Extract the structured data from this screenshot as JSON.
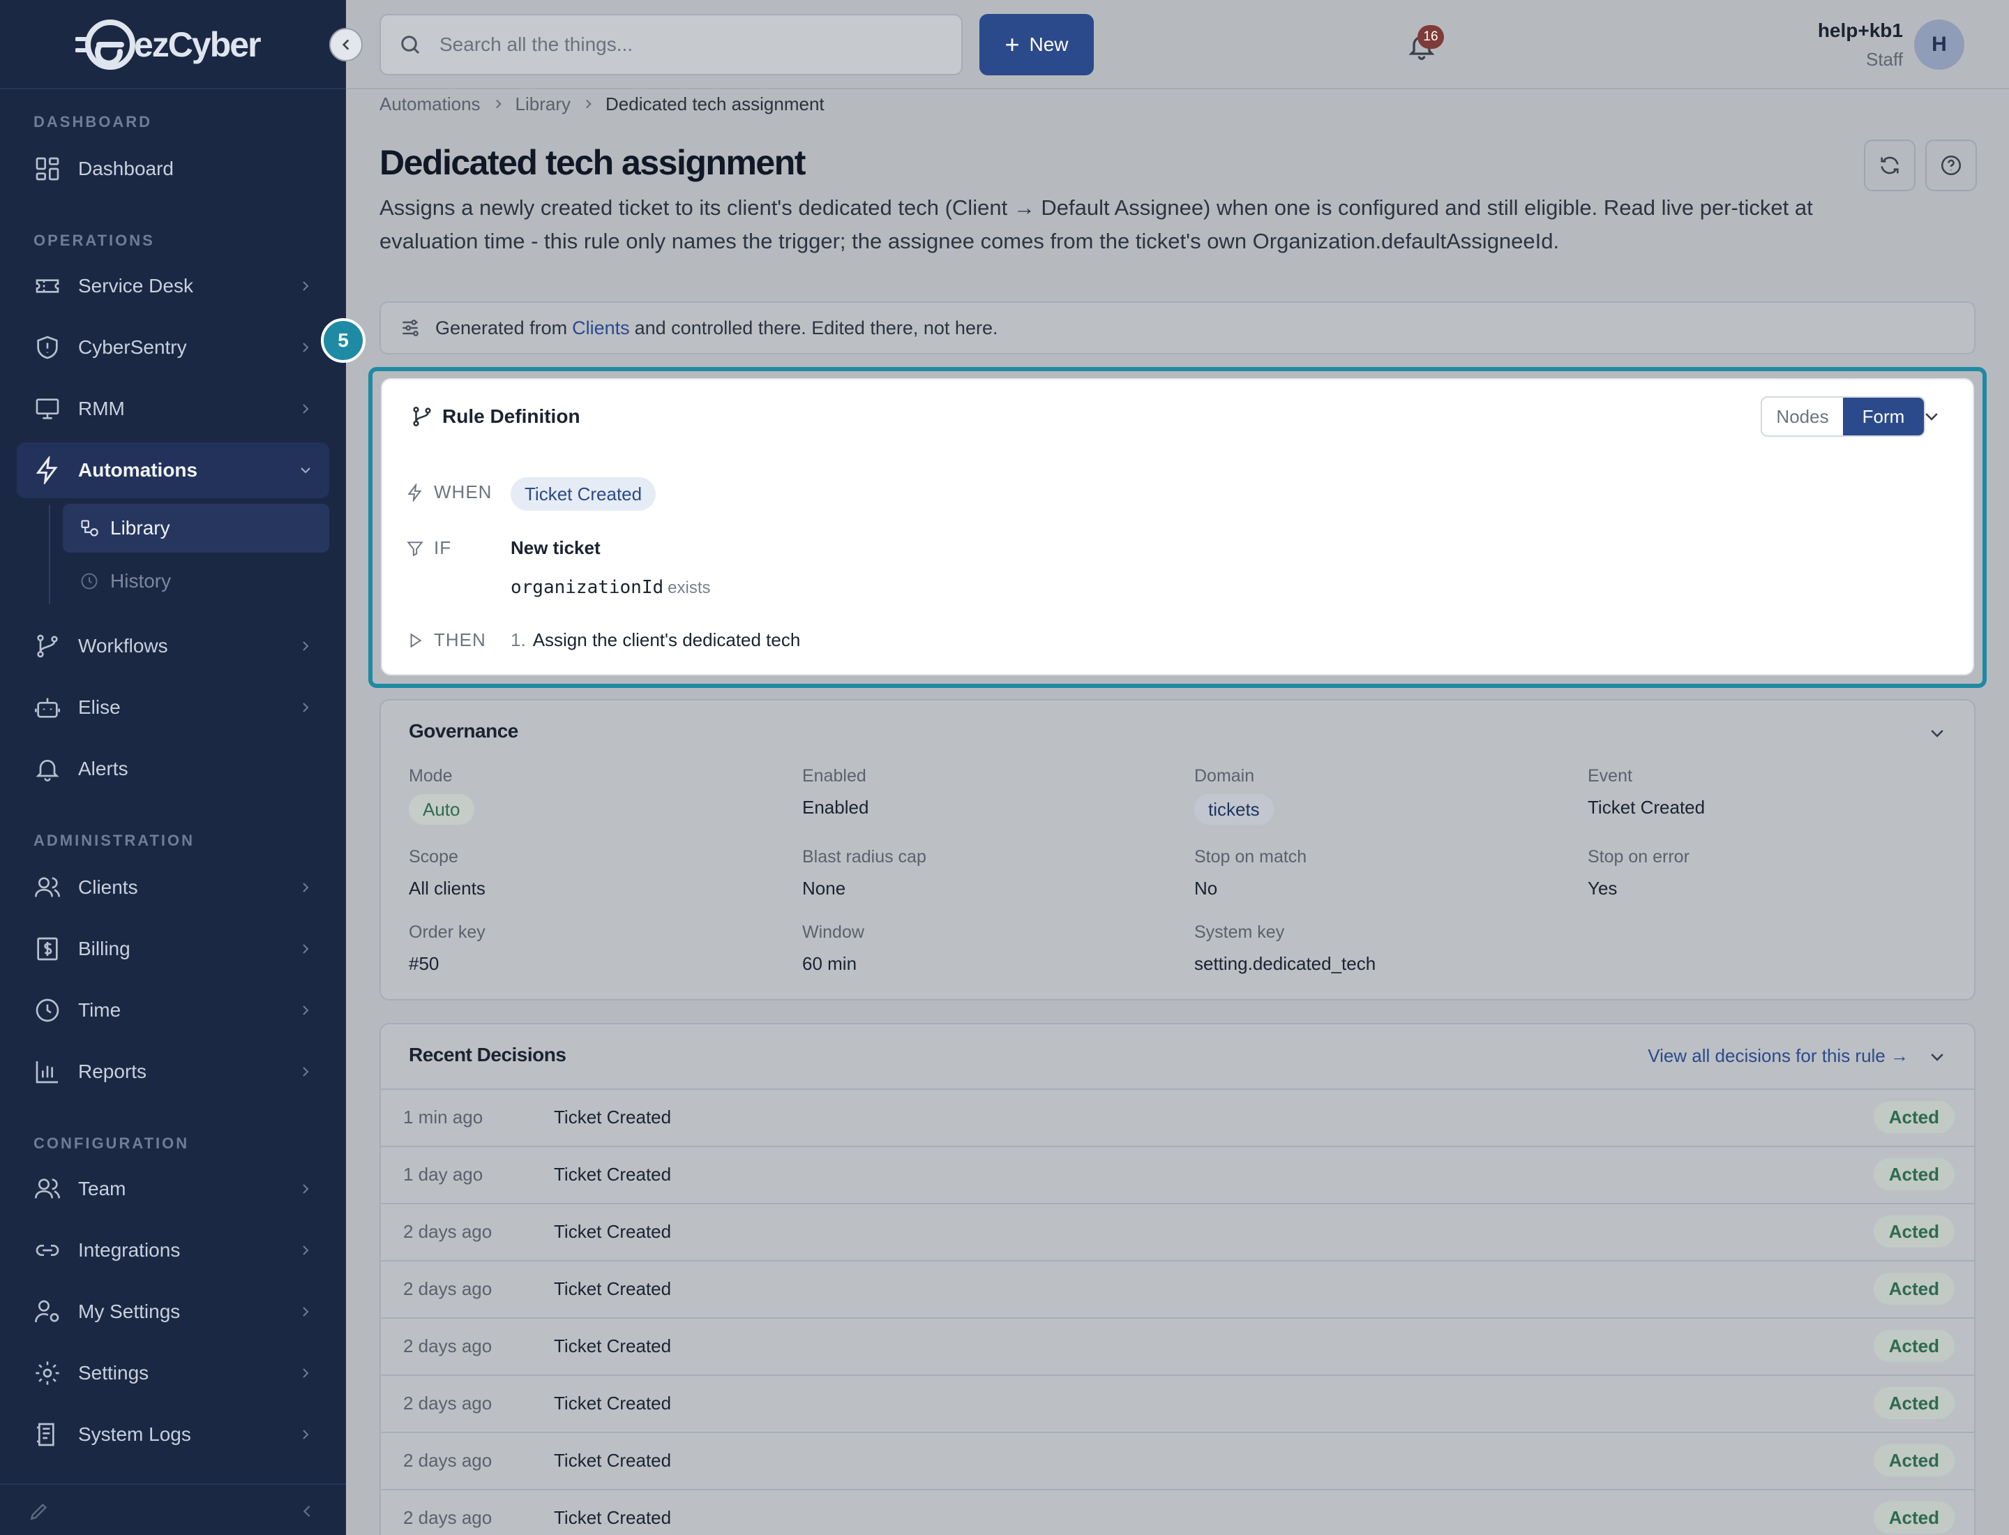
{
  "app": {
    "logo_text": "ezCyber"
  },
  "sidebar": {
    "sections": {
      "dashboard": "DASHBOARD",
      "operations": "OPERATIONS",
      "administration": "ADMINISTRATION",
      "configuration": "CONFIGURATION"
    },
    "items": {
      "dashboard": "Dashboard",
      "service_desk": "Service Desk",
      "cybersentry": "CyberSentry",
      "rmm": "RMM",
      "automations": "Automations",
      "library": "Library",
      "history": "History",
      "workflows": "Workflows",
      "elise": "Elise",
      "alerts": "Alerts",
      "clients": "Clients",
      "billing": "Billing",
      "time": "Time",
      "reports": "Reports",
      "team": "Team",
      "integrations": "Integrations",
      "my_settings": "My Settings",
      "settings": "Settings",
      "system_logs": "System Logs"
    }
  },
  "topbar": {
    "search_placeholder": "Search all the things...",
    "new_label": "New",
    "notification_count": "16",
    "user_name": "help+kb1",
    "user_role": "Staff",
    "avatar_initial": "H"
  },
  "breadcrumb": {
    "items": [
      "Automations",
      "Library",
      "Dedicated tech assignment"
    ]
  },
  "page": {
    "title": "Dedicated tech assignment",
    "description": "Assigns a newly created ticket to its client's dedicated tech (Client → Default Assignee) when one is configured and still eligible. Read live per-ticket at evaluation time - this rule only names the trigger; the assignee comes from the ticket's own Organization.defaultAssigneeId."
  },
  "banner": {
    "prefix": "Generated from",
    "link": "Clients",
    "suffix": "and controlled there. Edited there, not here."
  },
  "step_badge": "5",
  "rule_definition": {
    "title": "Rule Definition",
    "view_options": [
      "Nodes",
      "Form"
    ],
    "selected_view": "Form",
    "when_label": "WHEN",
    "when_value": "Ticket Created",
    "if_label": "IF",
    "condition_title": "New ticket",
    "condition_field": "organizationId",
    "condition_op": "exists",
    "then_label": "THEN",
    "action_number": "1.",
    "action_text": "Assign the client's dedicated tech"
  },
  "governance": {
    "title": "Governance",
    "fields": [
      {
        "label": "Mode",
        "value": "Auto"
      },
      {
        "label": "Enabled",
        "value": "Enabled"
      },
      {
        "label": "Domain",
        "value": "tickets"
      },
      {
        "label": "Event",
        "value": "Ticket Created"
      },
      {
        "label": "Scope",
        "value": "All clients"
      },
      {
        "label": "Blast radius cap",
        "value": "None"
      },
      {
        "label": "Stop on match",
        "value": "No"
      },
      {
        "label": "Stop on error",
        "value": "Yes"
      },
      {
        "label": "Order key",
        "value": "#50"
      },
      {
        "label": "Window",
        "value": "60 min"
      },
      {
        "label": "System key",
        "value": "setting.dedicated_tech"
      }
    ]
  },
  "recent_decisions": {
    "title": "Recent Decisions",
    "view_all": "View all decisions for this rule →",
    "rows": [
      {
        "time": "1 min ago",
        "event": "Ticket Created",
        "status": "Acted"
      },
      {
        "time": "1 day ago",
        "event": "Ticket Created",
        "status": "Acted"
      },
      {
        "time": "2 days ago",
        "event": "Ticket Created",
        "status": "Acted"
      },
      {
        "time": "2 days ago",
        "event": "Ticket Created",
        "status": "Acted"
      },
      {
        "time": "2 days ago",
        "event": "Ticket Created",
        "status": "Acted"
      },
      {
        "time": "2 days ago",
        "event": "Ticket Created",
        "status": "Acted"
      },
      {
        "time": "2 days ago",
        "event": "Ticket Created",
        "status": "Acted"
      },
      {
        "time": "2 days ago",
        "event": "Ticket Created",
        "status": "Acted"
      }
    ]
  },
  "colors": {
    "sidebar_bg": "#1b2844",
    "accent": "#2b4a8b",
    "highlight": "#1f8aa3",
    "success": "#2e6a50"
  }
}
